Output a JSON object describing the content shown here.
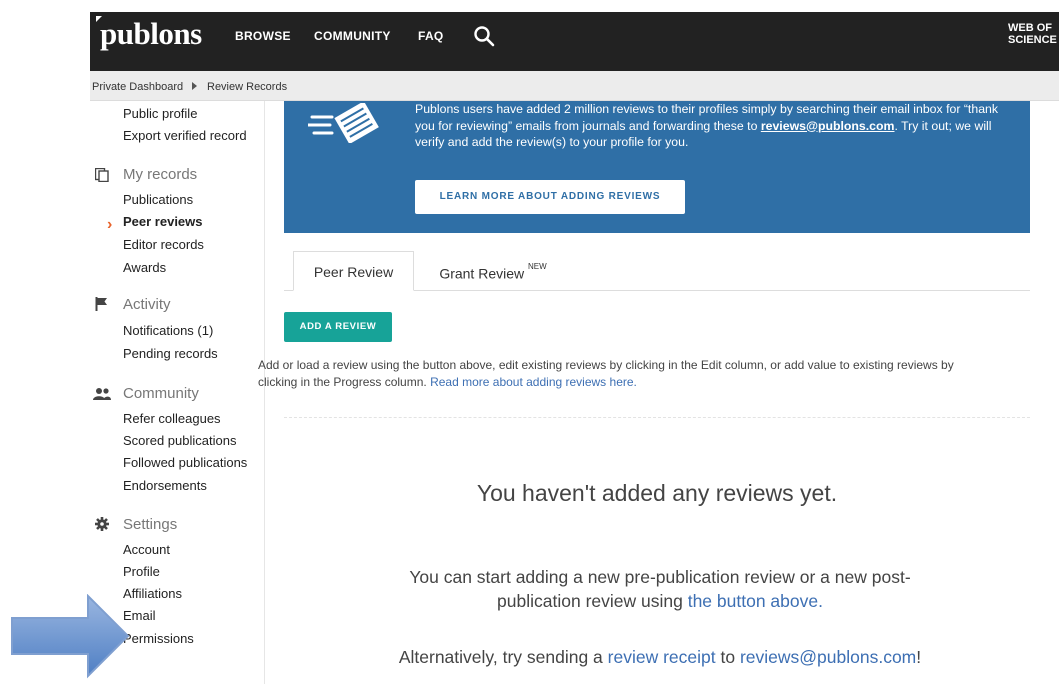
{
  "topbar": {
    "logo": "publons",
    "nav": [
      "BROWSE",
      "COMMUNITY",
      "FAQ"
    ],
    "wos_line1": "WEB OF",
    "wos_line2": "SCIENCE"
  },
  "breadcrumb": {
    "first": "Private Dashboard",
    "second": "Review Records"
  },
  "sidebar": {
    "profile_items": [
      "Public profile",
      "Export verified record"
    ],
    "my_records": {
      "heading": "My records",
      "items": [
        "Publications",
        "Peer reviews",
        "Editor records",
        "Awards"
      ]
    },
    "activity": {
      "heading": "Activity",
      "items": [
        "Notifications (1)",
        "Pending records"
      ]
    },
    "community": {
      "heading": "Community",
      "items": [
        "Refer colleagues",
        "Scored publications",
        "Followed publications",
        "Endorsements"
      ]
    },
    "settings": {
      "heading": "Settings",
      "items": [
        "Account",
        "Profile",
        "Affiliations",
        "Email",
        "Permissions"
      ]
    }
  },
  "banner": {
    "text_before": "Publons users have added 2 million reviews to their profiles simply by searching their email inbox for “thank you for reviewing” emails from journals and forwarding these to ",
    "email": "reviews@publons.com",
    "text_after": ". Try it out; we will verify and add the review(s) to your profile for you.",
    "button": "LEARN MORE ABOUT ADDING REVIEWS"
  },
  "tabs": {
    "peer": "Peer Review",
    "grant": "Grant Review",
    "grant_badge": "NEW"
  },
  "add_button": "ADD A REVIEW",
  "help": {
    "text": "Add or load a review using the button above, edit existing reviews by clicking in the Edit column, or add value to existing reviews by clicking in the Progress column. ",
    "link": "Read more about adding reviews here."
  },
  "empty": {
    "title": "You haven't added any reviews yet.",
    "line1": "You can start adding a new pre-publication review or a new post-",
    "line2_text": "publication review using ",
    "line2_link": "the button above.",
    "line3_text": "Alternatively, try sending a ",
    "line3_link1": "review receipt",
    "line3_mid": " to ",
    "line3_link2": "reviews@publons.com",
    "line3_end": "!"
  },
  "colors": {
    "topbar": "#222222",
    "banner": "#2f6fa6",
    "accent": "#17a398",
    "active_chevron": "#e8632b",
    "link": "#3d6fb3"
  },
  "icons": [
    "search-icon",
    "records-icon",
    "flag-icon",
    "people-icon",
    "gear-icon",
    "chevron-right-icon",
    "envelopes-icon"
  ]
}
